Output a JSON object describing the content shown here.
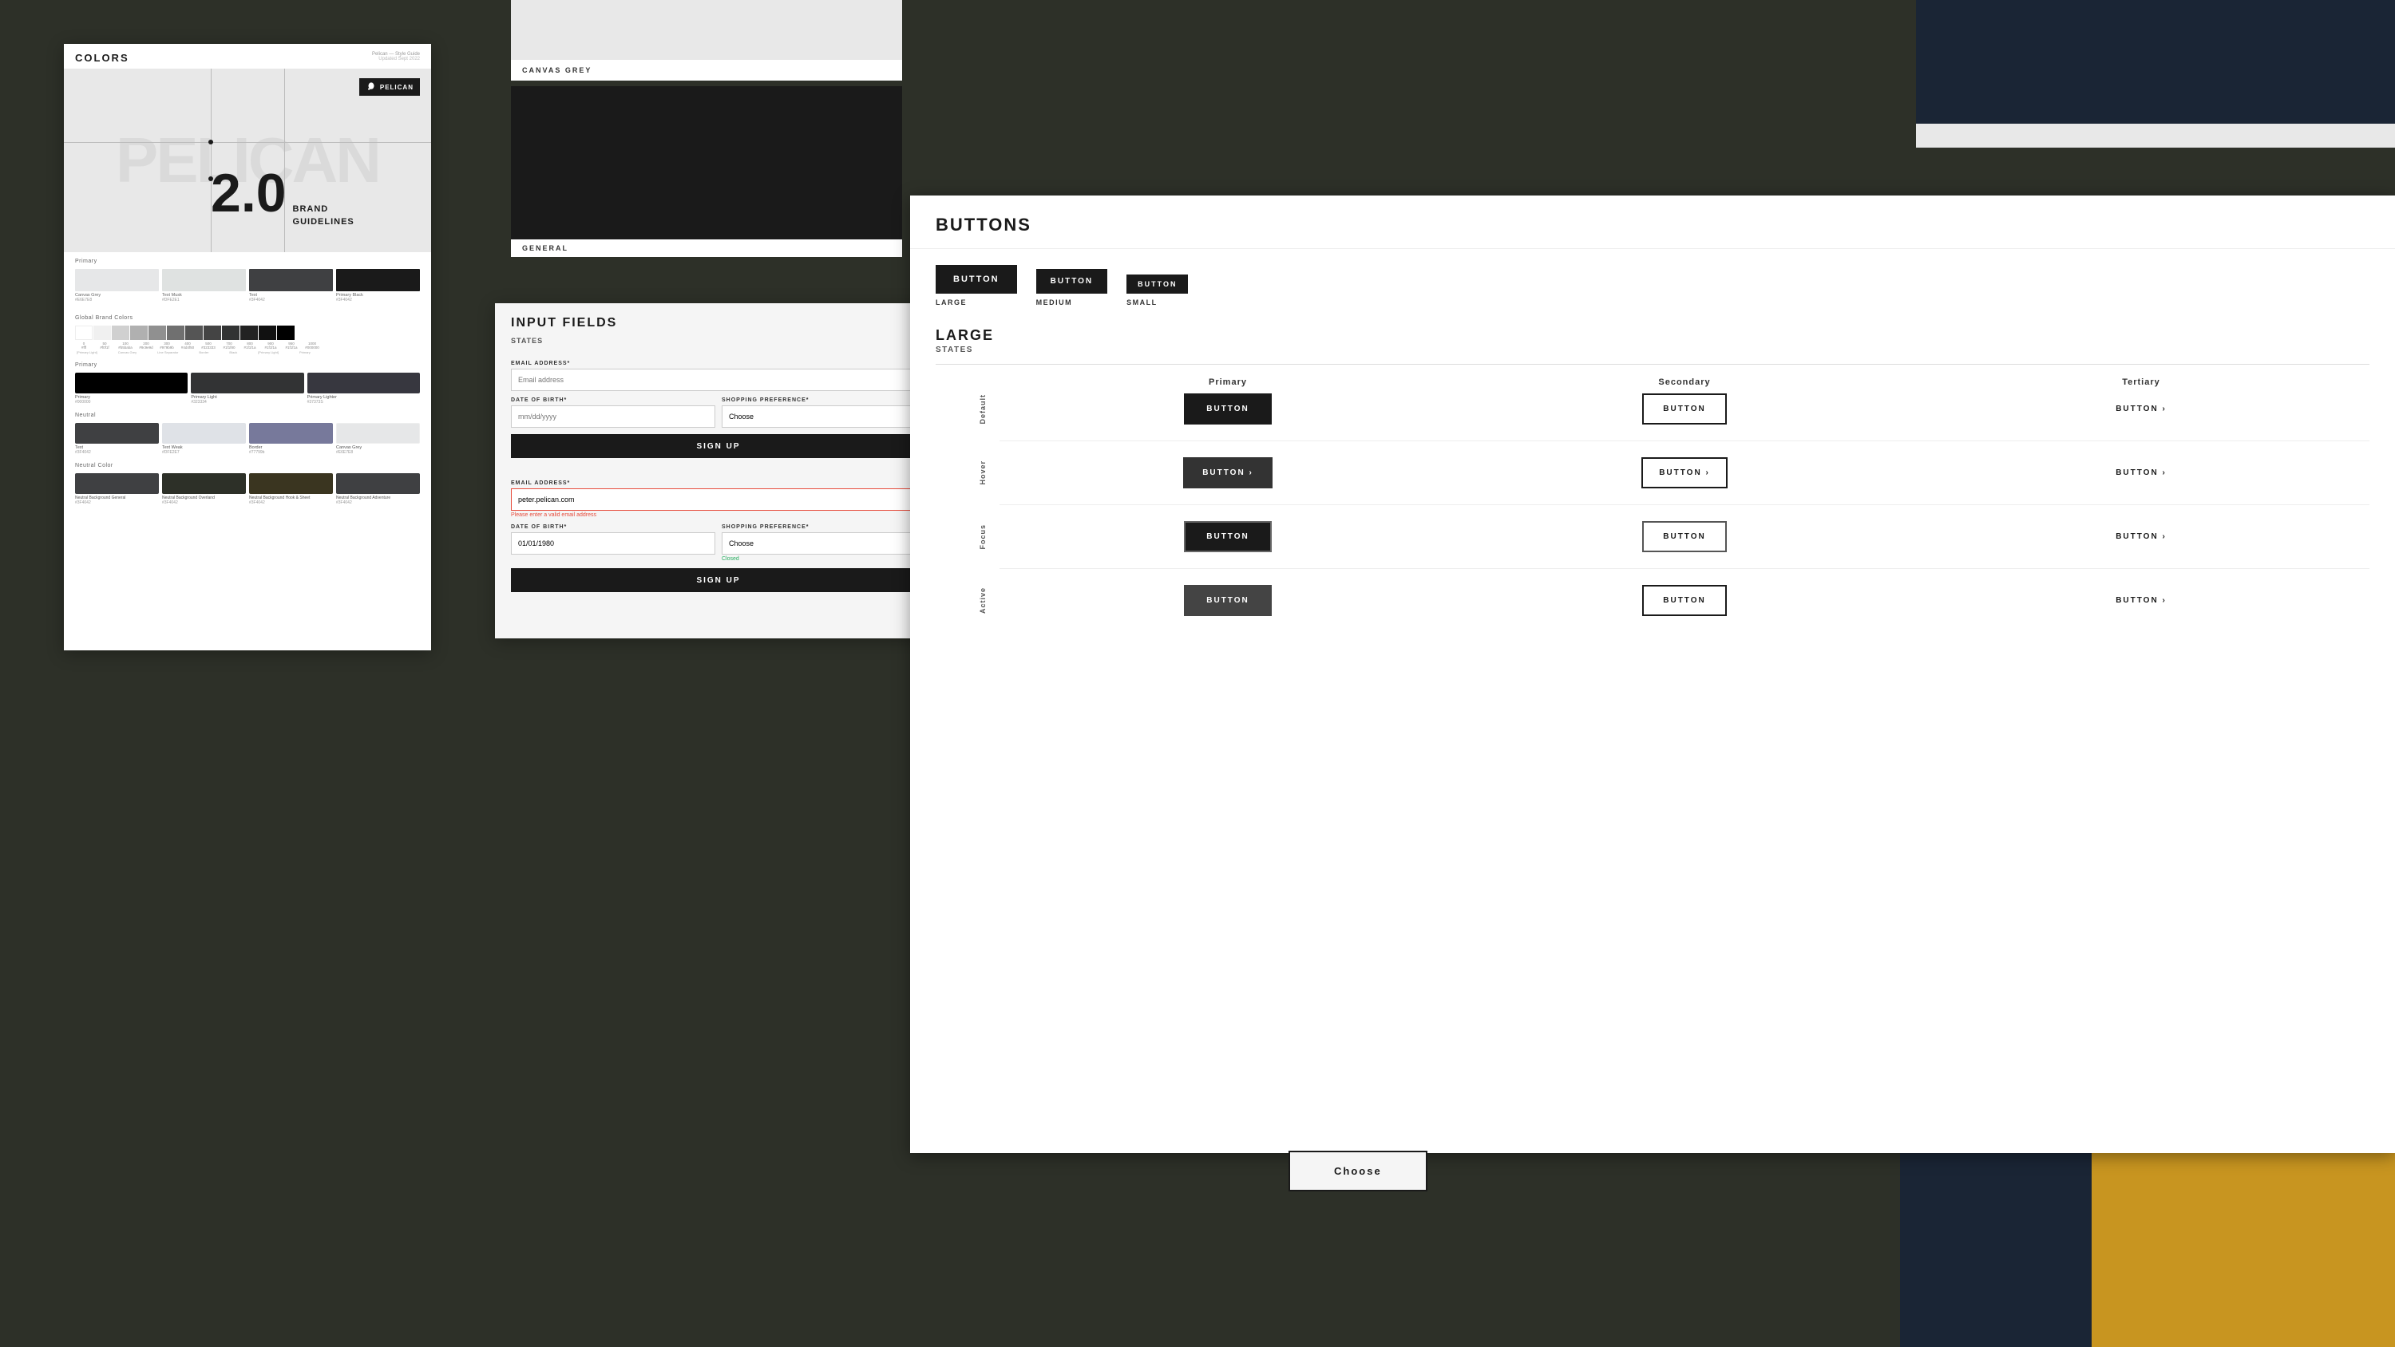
{
  "background": {
    "main_color": "#2d3028",
    "gold_color": "#7a6320",
    "navy_color": "#1a2535"
  },
  "style_guide": {
    "title": "COLORS",
    "brand_name": "Pelican — Style Guide",
    "updated": "Updated Sept 2022",
    "hero": {
      "version": "2.0",
      "brand_guidelines": "BRAND\nGUIDELINES",
      "watermark": "PELICAN"
    },
    "primary_label": "Primary",
    "swatches": {
      "canvas_grey": {
        "name": "Canvas Grey",
        "hex": "#E6E7E8"
      },
      "text_musk": {
        "name": "Text Musk",
        "hex": "#DFE2E1"
      },
      "text": {
        "name": "Text",
        "hex": "#3F4042"
      },
      "primary_black": {
        "name": "Primary Black",
        "hex": "#3F4042"
      }
    },
    "global_brand_label": "Global Brand Colors",
    "primary_section_label": "Primary",
    "primary_swatches": [
      {
        "name": "Primary",
        "hex": "#000000"
      },
      {
        "name": "Primary Light",
        "hex": "#323334"
      },
      {
        "name": "Primary Lighter",
        "hex": "#37373S"
      }
    ],
    "neutral_label": "Neutral",
    "neutral_swatches": [
      {
        "name": "Text",
        "hex": "#3F4042"
      },
      {
        "name": "Text Weak",
        "hex": "#DFE2E7"
      },
      {
        "name": "Border",
        "hex": "#77799b"
      },
      {
        "name": "Canvas Grey",
        "hex": "#E6E7E8"
      }
    ],
    "neutral_color_label": "Neutral Color",
    "neutral_background_swatches": [
      {
        "name": "Neutral Background General",
        "hex": "#3F4042"
      },
      {
        "name": "Neutral Background Overland",
        "hex": "#3F4042"
      },
      {
        "name": "Neutral Background Hook & Sheet",
        "hex": "#3F4042"
      },
      {
        "name": "Neutral Background Adventure",
        "hex": "#3F4042"
      }
    ]
  },
  "colors_top": {
    "canvas_grey_label": "CANVAS GREY",
    "general_label": "GENERAL"
  },
  "input_fields": {
    "title": "INPUT FIELDS",
    "states_label": "STATES",
    "default_section": {
      "email_label": "EMAIL ADDRESS*",
      "email_placeholder": "Email address",
      "dob_label": "DATE OF BIRTH*",
      "dob_placeholder": "mm/dd/yyyy",
      "shopping_label": "SHOPPING PREFERENCE*",
      "shopping_placeholder": "Choose",
      "submit_label": "SIGN UP"
    },
    "error_section": {
      "email_label": "EMAIL ADDRESS*",
      "email_value": "peter.pelican.com",
      "email_error": "Please enter a valid email address",
      "dob_label": "DATE OF BIRTH*",
      "dob_value": "01/01/1980",
      "shopping_label": "SHOPPING PREFERENCE*",
      "shopping_placeholder": "Choose",
      "success_message": "Closed",
      "submit_label": "SIGN UP"
    }
  },
  "buttons": {
    "title": "BUTTONS",
    "sizes": {
      "large": {
        "label": "BUTTON",
        "size_name": "LARGE"
      },
      "medium": {
        "label": "BUTTON",
        "size_name": "MEDIUM"
      },
      "small": {
        "label": "BUTTON",
        "size_name": "SMALL"
      }
    },
    "large_section_title": "LARGE",
    "states_label": "STATES",
    "columns": {
      "primary": "Primary",
      "secondary": "Secondary",
      "tertiary": "Tertiary"
    },
    "rows": {
      "default": {
        "label": "Default",
        "primary": "BUTTON",
        "secondary": "BUTTON",
        "tertiary": "BUTTON ›"
      },
      "hover": {
        "label": "Hover",
        "primary": "BUTTON ›",
        "secondary": "BUTTON ›",
        "tertiary": "BUTTON ›"
      },
      "focus": {
        "label": "Focus",
        "primary": "BUTTON",
        "secondary": "BUTTON",
        "tertiary": "BUTTON ›"
      },
      "active": {
        "label": "Active",
        "primary": "BUTTON",
        "secondary": "BUTTON",
        "tertiary": "BUTTON ›"
      }
    }
  },
  "choose_button": {
    "label": "Choose"
  }
}
